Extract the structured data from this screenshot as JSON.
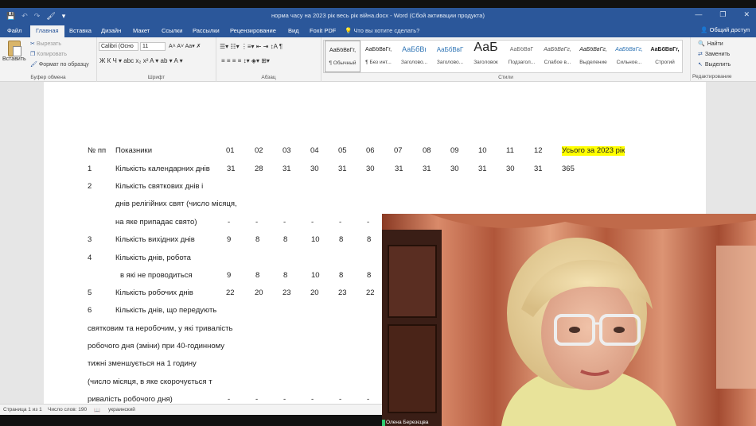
{
  "window": {
    "title": "норма часу  на 2023 рік весь рік війна.docx  -  Word (Сбой активации продукта)",
    "controls": [
      "—",
      "❐",
      "✕"
    ]
  },
  "qat": [
    "💾",
    "↶",
    "↷",
    "🖌",
    "▾"
  ],
  "tabs": [
    "Файл",
    "Главная",
    "Вставка",
    "Дизайн",
    "Макет",
    "Ссылки",
    "Рассылки",
    "Рецензирование",
    "Вид",
    "Foxit PDF"
  ],
  "tellme": "Что вы хотите сделать?",
  "share": "Общий доступ",
  "ribbon": {
    "clipboard": {
      "paste": "Вставить",
      "cut": "Вырезать",
      "copy": "Копировать",
      "painter": "Формат по образцу",
      "label": "Буфер обмена"
    },
    "font": {
      "name": "Calibri (Осно",
      "size": "11",
      "label": "Шрифт",
      "row1": "A˄ A˅  Aa▾  ✗",
      "row2": "Ж  К  Ч ▾  abc  x₂  x²  A ▾  ab ▾  A ▾"
    },
    "paragraph": {
      "label": "Абзац",
      "row1": "☰▾  ☷▾  ⋮≡▾  ⇤  ⇥  ↕A  ¶",
      "row2": "≡  ≡  ≡  ≡  ↕▾  ◈▾  ⊞▾"
    },
    "styles": {
      "label": "Стили",
      "items": [
        {
          "preview": "АаБбВвГг,",
          "name": "¶ Обычный"
        },
        {
          "preview": "АаБбВвГг,",
          "name": "¶ Без инт..."
        },
        {
          "preview": "АаБбВı",
          "name": "Заголово..."
        },
        {
          "preview": "АаБбВвГ",
          "name": "Заголово..."
        },
        {
          "preview": "АаБ",
          "name": "Заголовок"
        },
        {
          "preview": "АаБбВвГ",
          "name": "Подзагол..."
        },
        {
          "preview": "АаБбВвГг,",
          "name": "Слабое в..."
        },
        {
          "preview": "АаБбВвГг,",
          "name": "Выделение"
        },
        {
          "preview": "АаБбВвГг,",
          "name": "Сильное..."
        },
        {
          "preview": "АаБбВвГг,",
          "name": "Строгий"
        }
      ]
    },
    "editing": {
      "find": "Найти",
      "replace": "Заменить",
      "select": "Выделить",
      "label": "Редактирование"
    }
  },
  "document": {
    "header": {
      "num": "№ пп",
      "label": "Показники",
      "months": [
        "01",
        "02",
        "03",
        "04",
        "05",
        "06",
        "07",
        "08",
        "09",
        "10",
        "11",
        "12"
      ],
      "total": "Усього за 2023 рік"
    },
    "row1": {
      "num": "1",
      "label": "Кількість календарних днів",
      "values": [
        "31",
        "28",
        "31",
        "30",
        "31",
        "30",
        "31",
        "31",
        "30",
        "31",
        "30",
        "31"
      ],
      "total": "365"
    },
    "row2": {
      "num": "2",
      "line1": "Кількість святкових днів і",
      "line2": "днів релігійних свят (число місяця,",
      "line3": "на яке припадає свято)",
      "values": [
        "-",
        "-",
        "-",
        "-",
        "-",
        "-"
      ]
    },
    "row3": {
      "num": "3",
      "label": "Кількість вихідних днів",
      "values": [
        "9",
        "8",
        "8",
        "10",
        "8",
        "8"
      ]
    },
    "row4": {
      "num": "4",
      "line1": "Кількість днів, робота",
      "line2": "в які не проводиться",
      "values": [
        "9",
        "8",
        "8",
        "10",
        "8",
        "8"
      ]
    },
    "row5": {
      "num": "5",
      "label": "Кількість робочих днів",
      "values": [
        "22",
        "20",
        "23",
        "20",
        "23",
        "22"
      ]
    },
    "row6": {
      "num": "6",
      "line1": "Кількість днів, що передують",
      "line2": "святковим та неробочим, у які тривалість",
      "line3": "робочого дня (зміни) при 40-годинному",
      "line4": "тижні зменшується на 1 годину",
      "line5": "(число місяця, в яке скорочується т",
      "line6": "ривалість робочого дня)",
      "values": [
        "-",
        "-",
        "-",
        "-",
        "-",
        "-"
      ]
    }
  },
  "status": {
    "page": "Страница 1 из 1",
    "words": "Число слов: 190",
    "lang": "украинский"
  },
  "video": {
    "participant": "Олена Березєцва"
  }
}
